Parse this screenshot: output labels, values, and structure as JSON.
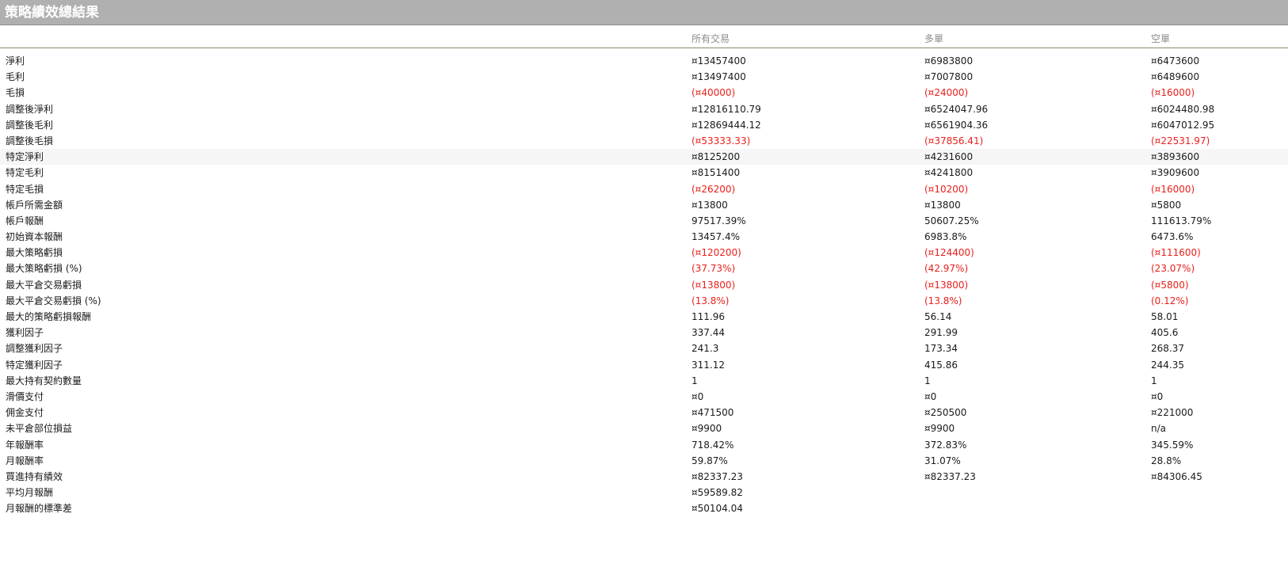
{
  "window": {
    "title": "策略績效總結果"
  },
  "columns": [
    "",
    "所有交易",
    "多單",
    "空單"
  ],
  "rows": [
    {
      "label": "淨利",
      "all": "¤13457400",
      "long": "¤6983800",
      "short": "¤6473600",
      "neg": false
    },
    {
      "label": "毛利",
      "all": "¤13497400",
      "long": "¤7007800",
      "short": "¤6489600",
      "neg": false
    },
    {
      "label": "毛損",
      "all": "(¤40000)",
      "long": "(¤24000)",
      "short": "(¤16000)",
      "neg": true
    },
    {
      "label": "調整後淨利",
      "all": "¤12816110.79",
      "long": "¤6524047.96",
      "short": "¤6024480.98",
      "neg": false
    },
    {
      "label": "調整後毛利",
      "all": "¤12869444.12",
      "long": "¤6561904.36",
      "short": "¤6047012.95",
      "neg": false
    },
    {
      "label": "調整後毛損",
      "all": "(¤53333.33)",
      "long": "(¤37856.41)",
      "short": "(¤22531.97)",
      "neg": true
    },
    {
      "label": "特定淨利",
      "all": "¤8125200",
      "long": "¤4231600",
      "short": "¤3893600",
      "neg": false,
      "highlight": true
    },
    {
      "label": "特定毛利",
      "all": "¤8151400",
      "long": "¤4241800",
      "short": "¤3909600",
      "neg": false
    },
    {
      "label": "特定毛損",
      "all": "(¤26200)",
      "long": "(¤10200)",
      "short": "(¤16000)",
      "neg": true
    },
    {
      "label": "帳戶所需金額",
      "all": "¤13800",
      "long": "¤13800",
      "short": "¤5800",
      "neg": false
    },
    {
      "label": "帳戶報酬",
      "all": "97517.39%",
      "long": "50607.25%",
      "short": "111613.79%",
      "neg": false
    },
    {
      "label": "初始資本報酬",
      "all": "13457.4%",
      "long": "6983.8%",
      "short": "6473.6%",
      "neg": false
    },
    {
      "label": "最大策略虧損",
      "all": "(¤120200)",
      "long": "(¤124400)",
      "short": "(¤111600)",
      "neg": true
    },
    {
      "label": "最大策略虧損 (%)",
      "all": "(37.73%)",
      "long": "(42.97%)",
      "short": "(23.07%)",
      "neg": true
    },
    {
      "label": "最大平倉交易虧損",
      "all": "(¤13800)",
      "long": "(¤13800)",
      "short": "(¤5800)",
      "neg": true
    },
    {
      "label": "最大平倉交易虧損 (%)",
      "all": "(13.8%)",
      "long": "(13.8%)",
      "short": "(0.12%)",
      "neg": true
    },
    {
      "label": "最大的策略虧損報酬",
      "all": "111.96",
      "long": "56.14",
      "short": "58.01",
      "neg": false
    },
    {
      "label": "獲利因子",
      "all": "337.44",
      "long": "291.99",
      "short": "405.6",
      "neg": false
    },
    {
      "label": "調整獲利因子",
      "all": "241.3",
      "long": "173.34",
      "short": "268.37",
      "neg": false
    },
    {
      "label": "特定獲利因子",
      "all": "311.12",
      "long": "415.86",
      "short": "244.35",
      "neg": false
    },
    {
      "label": "最大持有契約數量",
      "all": "1",
      "long": "1",
      "short": "1",
      "neg": false
    },
    {
      "label": "滑價支付",
      "all": "¤0",
      "long": "¤0",
      "short": "¤0",
      "neg": false
    },
    {
      "label": "佣金支付",
      "all": "¤471500",
      "long": "¤250500",
      "short": "¤221000",
      "neg": false
    },
    {
      "label": "未平倉部位損益",
      "all": "¤9900",
      "long": "¤9900",
      "short": "n/a",
      "neg": false
    },
    {
      "label": "年報酬率",
      "all": "718.42%",
      "long": "372.83%",
      "short": "345.59%",
      "neg": false
    },
    {
      "label": "月報酬率",
      "all": "59.87%",
      "long": "31.07%",
      "short": "28.8%",
      "neg": false
    },
    {
      "label": "買進持有績效",
      "all": "¤82337.23",
      "long": "¤82337.23",
      "short": "¤84306.45",
      "neg": false
    },
    {
      "label": "平均月報酬",
      "all": "¤59589.82",
      "long": "",
      "short": "",
      "neg": false
    },
    {
      "label": "月報酬的標準差",
      "all": "¤50104.04",
      "long": "",
      "short": "",
      "neg": false
    }
  ]
}
